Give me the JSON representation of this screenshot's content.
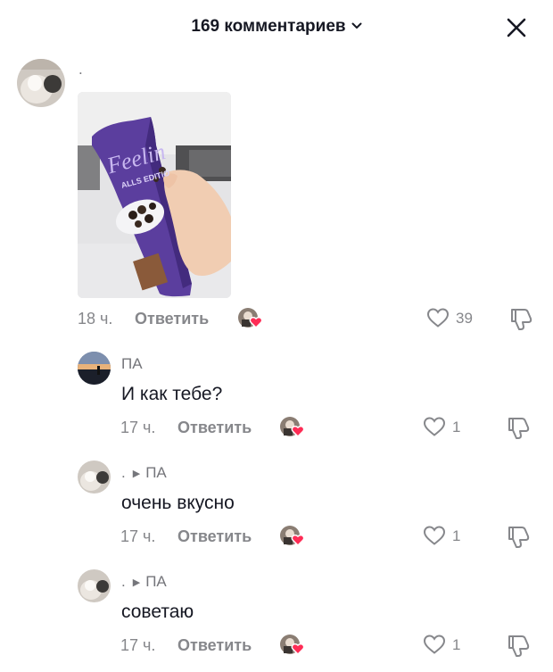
{
  "header": {
    "title": "169 комментариев"
  },
  "comments": [
    {
      "author": ".",
      "time": "18 ч.",
      "reply_label": "Ответить",
      "likes": "39",
      "photo": {
        "product_text": "Feelin",
        "edition_text": "ALLS EDITIO"
      }
    },
    {
      "author": "ПА",
      "text": "И как тебе?",
      "time": "17 ч.",
      "reply_label": "Ответить",
      "likes": "1"
    },
    {
      "author": ".",
      "reply_to": "ПА",
      "text": "очень вкусно",
      "time": "17 ч.",
      "reply_label": "Ответить",
      "likes": "1"
    },
    {
      "author": ".",
      "reply_to": "ПА",
      "text": "советаю",
      "time": "17 ч.",
      "reply_label": "Ответить",
      "likes": "1"
    }
  ]
}
